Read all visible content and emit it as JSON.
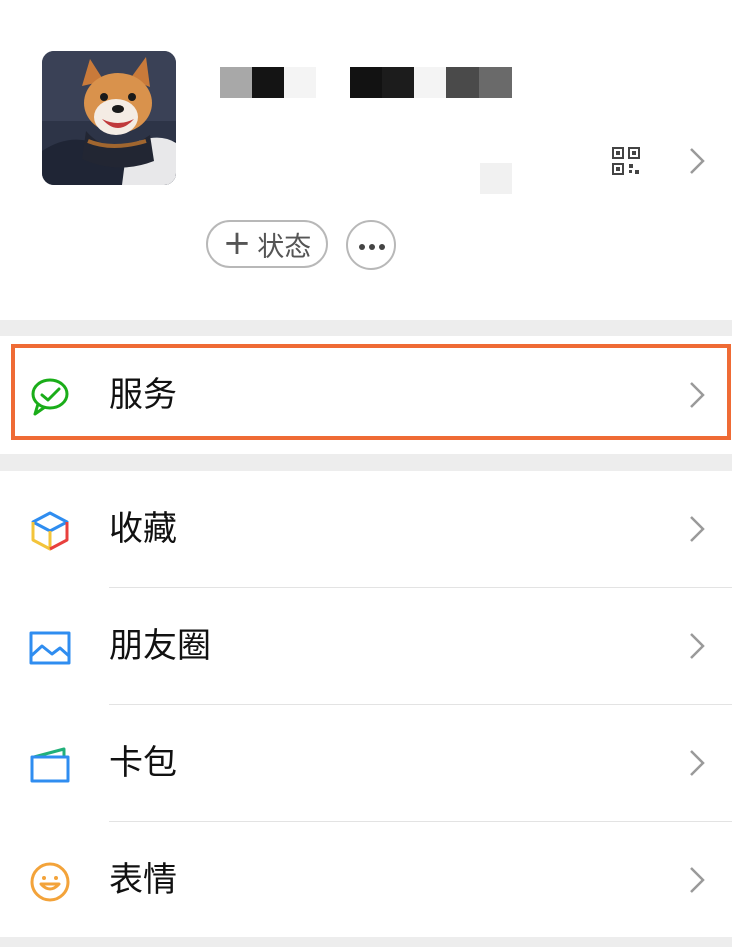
{
  "profile": {
    "status_label": "状态",
    "avatar_icon": "dog-photo-avatar",
    "qr_icon": "qr-code-icon"
  },
  "menu": {
    "service": {
      "label": "服务",
      "icon": "wechat-pay-icon",
      "color": "#1aad19"
    },
    "items": [
      {
        "label": "收藏",
        "icon": "favorites-cube-icon"
      },
      {
        "label": "朋友圈",
        "icon": "moments-picture-icon"
      },
      {
        "label": "卡包",
        "icon": "card-wallet-icon"
      },
      {
        "label": "表情",
        "icon": "smiley-icon"
      }
    ]
  },
  "colors": {
    "highlight": "#ef6b35",
    "background": "#ededed",
    "moments": "#2f8df0",
    "emoji": "#f3a33a"
  }
}
